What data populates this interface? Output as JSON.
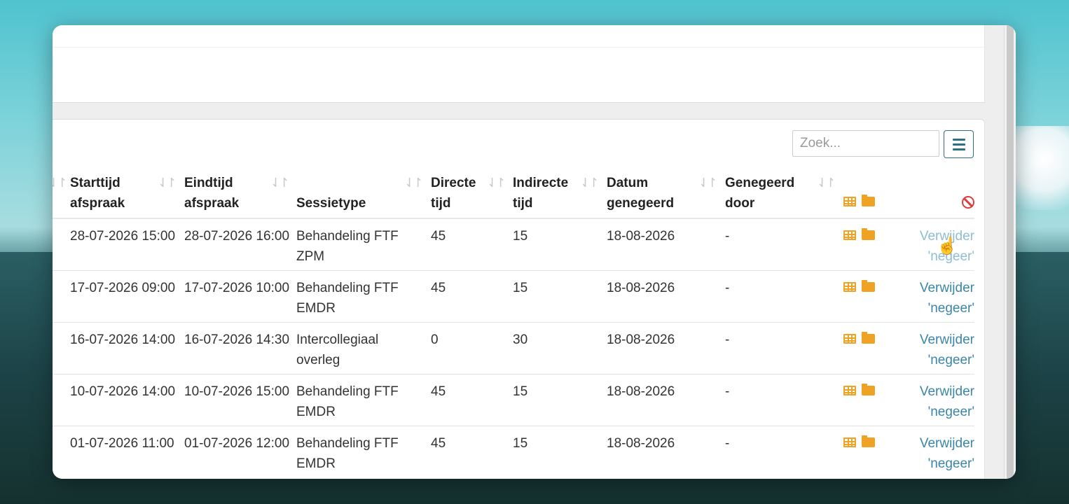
{
  "search": {
    "placeholder": "Zoek..."
  },
  "table": {
    "headers": [
      {
        "line1": "Starttijd",
        "line2": "afspraak"
      },
      {
        "line1": "Eindtijd",
        "line2": "afspraak"
      },
      {
        "line1": "",
        "line2": "Sessietype"
      },
      {
        "line1": "Directe",
        "line2": "tijd"
      },
      {
        "line1": "Indirecte",
        "line2": "tijd"
      },
      {
        "line1": "Datum",
        "line2": "genegeerd"
      },
      {
        "line1": "Genegeerd",
        "line2": "door"
      }
    ],
    "rows": [
      {
        "start": "28-07-2026 15:00",
        "end": "28-07-2026 16:00",
        "type1": "Behandeling FTF",
        "type2": "ZPM",
        "direct": "45",
        "indirect": "15",
        "date": "18-08-2026",
        "by": "-",
        "action1": "Verwijder",
        "action2": "'negeer'"
      },
      {
        "start": "17-07-2026 09:00",
        "end": "17-07-2026 10:00",
        "type1": "Behandeling FTF",
        "type2": "EMDR",
        "direct": "45",
        "indirect": "15",
        "date": "18-08-2026",
        "by": "-",
        "action1": "Verwijder",
        "action2": "'negeer'"
      },
      {
        "start": "16-07-2026 14:00",
        "end": "16-07-2026 14:30",
        "type1": "Intercollegiaal",
        "type2": "overleg",
        "direct": "0",
        "indirect": "30",
        "date": "18-08-2026",
        "by": "-",
        "action1": "Verwijder",
        "action2": "'negeer'"
      },
      {
        "start": "10-07-2026 14:00",
        "end": "10-07-2026 15:00",
        "type1": "Behandeling FTF",
        "type2": "EMDR",
        "direct": "45",
        "indirect": "15",
        "date": "18-08-2026",
        "by": "-",
        "action1": "Verwijder",
        "action2": "'negeer'"
      },
      {
        "start": "01-07-2026 11:00",
        "end": "01-07-2026 12:00",
        "type1": "Behandeling FTF",
        "type2": "EMDR",
        "direct": "45",
        "indirect": "15",
        "date": "18-08-2026",
        "by": "-",
        "action1": "Verwijder",
        "action2": "'negeer'"
      }
    ]
  },
  "colors": {
    "accent": "#2f6f86",
    "link": "#3a86a8",
    "icon": "#f0a224",
    "ban": "#e03c3c"
  }
}
